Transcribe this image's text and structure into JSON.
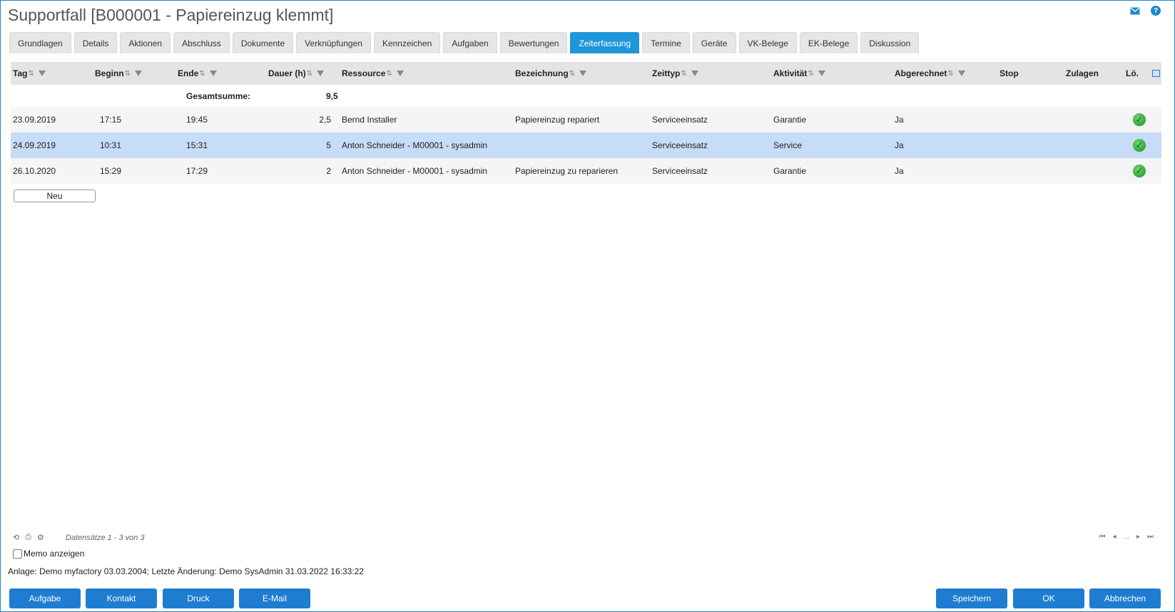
{
  "window": {
    "title": "Supportfall [B000001 - Papiereinzug klemmt]"
  },
  "icons": {
    "mail": "mail-icon",
    "help": "help-icon",
    "help_glyph": "?",
    "accent_color": "#1e96d8",
    "check_color": "#1c8f1c"
  },
  "tabs": [
    {
      "label": "Grundlagen"
    },
    {
      "label": "Details"
    },
    {
      "label": "Aktionen"
    },
    {
      "label": "Abschluss"
    },
    {
      "label": "Dokumente"
    },
    {
      "label": "Verknüpfungen"
    },
    {
      "label": "Kennzeichen"
    },
    {
      "label": "Aufgaben"
    },
    {
      "label": "Bewertungen"
    },
    {
      "label": "Zeiterfassung",
      "active": true
    },
    {
      "label": "Termine"
    },
    {
      "label": "Geräte"
    },
    {
      "label": "VK-Belege"
    },
    {
      "label": "EK-Belege"
    },
    {
      "label": "Diskussion"
    }
  ],
  "grid": {
    "columns": {
      "tag": "Tag",
      "beginn": "Beginn",
      "ende": "Ende",
      "dauer": "Dauer (h)",
      "ressource": "Ressource",
      "bezeichnung": "Bezeichnung",
      "zeittyp": "Zeittyp",
      "aktivitaet": "Aktivität",
      "abgerechnet": "Abgerechnet",
      "stop": "Stop",
      "zulagen": "Zulagen",
      "loeschen": "Lö."
    },
    "summary": {
      "label": "Gesamtsumme:",
      "value": "9,5"
    },
    "rows": [
      {
        "tag": "23.09.2019",
        "beginn": "17:15",
        "ende": "19:45",
        "dauer": "2,5",
        "ressource": "Bernd Installer",
        "bezeichnung": "Papiereinzug repariert",
        "zeittyp": "Serviceeinsatz",
        "aktivitaet": "Garantie",
        "abgerechnet": "Ja",
        "stop": "",
        "zulagen": ""
      },
      {
        "tag": "24.09.2019",
        "beginn": "10:31",
        "ende": "15:31",
        "dauer": "5",
        "ressource": "Anton Schneider - M00001 - sysadmin",
        "bezeichnung": "",
        "zeittyp": "Serviceeinsatz",
        "aktivitaet": "Service",
        "abgerechnet": "Ja",
        "stop": "",
        "zulagen": "",
        "selected": true
      },
      {
        "tag": "26.10.2020",
        "beginn": "15:29",
        "ende": "17:29",
        "dauer": "2",
        "ressource": "Anton Schneider - M00001 - sysadmin",
        "bezeichnung": "Papiereinzug zu reparieren",
        "zeittyp": "Serviceeinsatz",
        "aktivitaet": "Garantie",
        "abgerechnet": "Ja",
        "stop": "",
        "zulagen": ""
      }
    ],
    "new_button": "Neu"
  },
  "footer": {
    "records": "Datensätze 1 - 3 von 3",
    "pager_ellipsis": "...",
    "memo_label": "Memo anzeigen",
    "meta": "Anlage: Demo myfactory 03.03.2004; Letzte Änderung: Demo SysAdmin 31.03.2022 16:33:22"
  },
  "buttons": {
    "aufgabe": "Aufgabe",
    "kontakt": "Kontakt",
    "druck": "Druck",
    "email": "E-Mail",
    "speichern": "Speichern",
    "ok": "OK",
    "abbrechen": "Abbrechen"
  }
}
